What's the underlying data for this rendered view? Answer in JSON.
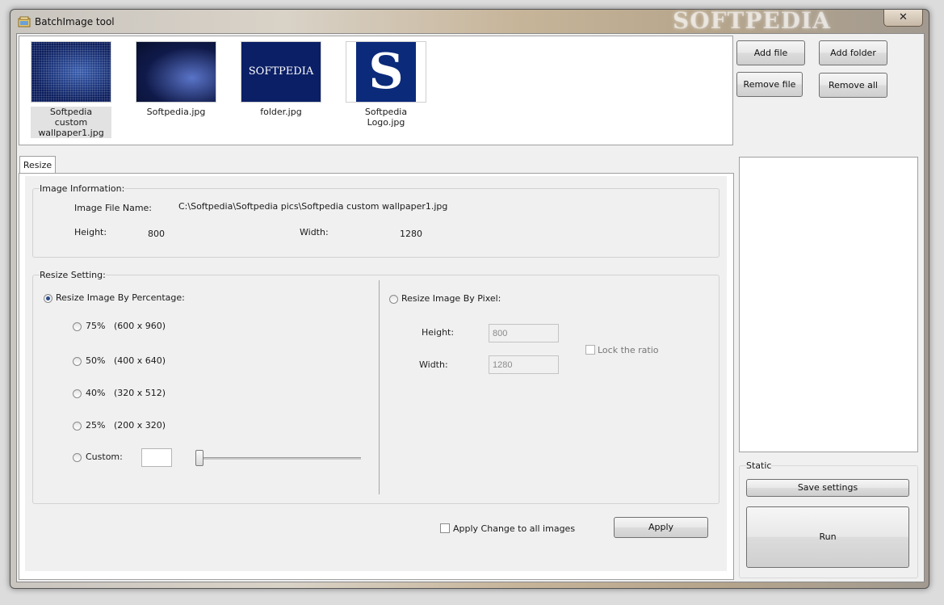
{
  "window": {
    "title": "BatchImage tool",
    "close_label": "✕",
    "watermark": "SOFTPEDIA"
  },
  "thumbnails": [
    {
      "caption_line1": "Softpedia custom",
      "caption_line2": "wallpaper1.jpg"
    },
    {
      "caption_line1": "Softpedia.jpg",
      "caption_line2": ""
    },
    {
      "caption_line1": "folder.jpg",
      "caption_line2": "",
      "image_text": "SOFTPEDIA"
    },
    {
      "caption_line1": "Softpedia Logo.jpg",
      "caption_line2": "",
      "image_text": "S"
    }
  ],
  "file_buttons": {
    "add_file": "Add file",
    "add_folder": "Add folder",
    "remove_file": "Remove file",
    "remove_all": "Remove all"
  },
  "tab": {
    "label": "Resize"
  },
  "image_info": {
    "legend": "Image Information:",
    "file_name_label": "Image File Name:",
    "file_name_value": "C:\\Softpedia\\Softpedia pics\\Softpedia custom wallpaper1.jpg",
    "height_label": "Height:",
    "height_value": "800",
    "width_label": "Width:",
    "width_value": "1280"
  },
  "resize_setting": {
    "legend": "Resize Setting:",
    "by_percentage_label": "Resize Image By Percentage:",
    "options": [
      {
        "pct": "75%",
        "dims": "(600 x 960)"
      },
      {
        "pct": "50%",
        "dims": "(400 x 640)"
      },
      {
        "pct": "40%",
        "dims": "(320 x 512)"
      },
      {
        "pct": "25%",
        "dims": "(200 x 320)"
      }
    ],
    "custom_label": "Custom:",
    "custom_value": "",
    "slider_fraction": 0,
    "by_pixel_label": "Resize Image By Pixel:",
    "pixel_height_label": "Height:",
    "pixel_height_value": "800",
    "pixel_width_label": "Width:",
    "pixel_width_value": "1280",
    "lock_ratio_label": "Lock the ratio"
  },
  "apply_all_label": "Apply Change to all images",
  "apply_label": "Apply",
  "static_group": {
    "legend": "Static",
    "save_settings_label": "Save settings",
    "run_label": "Run"
  }
}
